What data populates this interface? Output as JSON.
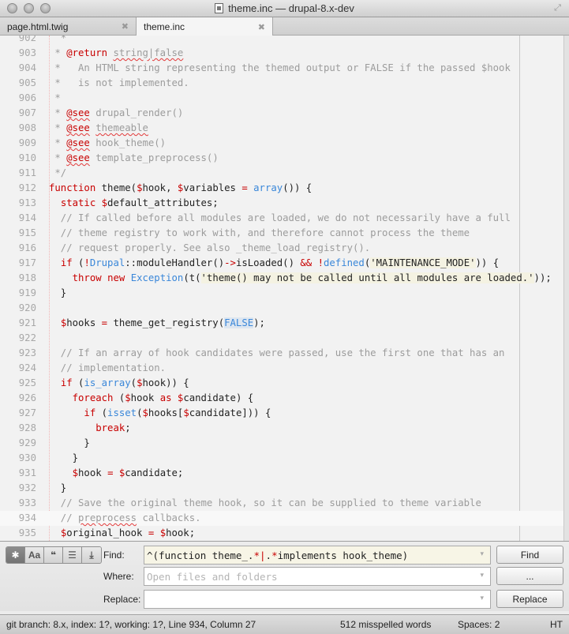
{
  "window": {
    "title": "theme.inc — drupal-8.x-dev"
  },
  "tabs": [
    {
      "label": "page.html.twig",
      "active": false
    },
    {
      "label": "theme.inc",
      "active": true
    }
  ],
  "editor": {
    "current_line": 934,
    "lines": [
      {
        "n": "902",
        "t": [
          [
            "cm",
            "  *"
          ]
        ]
      },
      {
        "n": "903",
        "t": [
          [
            "cm",
            " * "
          ],
          [
            "tag",
            "@return"
          ],
          [
            "cm",
            " "
          ],
          [
            "cms",
            "string|false"
          ]
        ]
      },
      {
        "n": "904",
        "t": [
          [
            "cm",
            " *   An HTML string representing the themed output or FALSE if the passed $hook"
          ]
        ]
      },
      {
        "n": "905",
        "t": [
          [
            "cm",
            " *   is not implemented."
          ]
        ]
      },
      {
        "n": "906",
        "t": [
          [
            "cm",
            " *"
          ]
        ]
      },
      {
        "n": "907",
        "t": [
          [
            "cm",
            " * "
          ],
          [
            "tags",
            "@see"
          ],
          [
            "cm",
            " drupal_render()"
          ]
        ]
      },
      {
        "n": "908",
        "t": [
          [
            "cm",
            " * "
          ],
          [
            "tags",
            "@see"
          ],
          [
            "cm",
            " "
          ],
          [
            "cms",
            "themeable"
          ]
        ]
      },
      {
        "n": "909",
        "t": [
          [
            "cm",
            " * "
          ],
          [
            "tags",
            "@see"
          ],
          [
            "cm",
            " hook_theme()"
          ]
        ]
      },
      {
        "n": "910",
        "t": [
          [
            "cm",
            " * "
          ],
          [
            "tags",
            "@see"
          ],
          [
            "cm",
            " template_preprocess()"
          ]
        ]
      },
      {
        "n": "911",
        "t": [
          [
            "cm",
            " */"
          ]
        ]
      },
      {
        "n": "912",
        "t": [
          [
            "kw",
            "function"
          ],
          [
            "tx",
            " theme("
          ],
          [
            "var",
            "$"
          ],
          [
            "tx",
            "hook, "
          ],
          [
            "var",
            "$"
          ],
          [
            "tx",
            "variables "
          ],
          [
            "op",
            "="
          ],
          [
            "tx",
            " "
          ],
          [
            "fn",
            "array"
          ],
          [
            "tx",
            "()) {"
          ]
        ]
      },
      {
        "n": "913",
        "t": [
          [
            "tx",
            "  "
          ],
          [
            "kw",
            "static"
          ],
          [
            "tx",
            " "
          ],
          [
            "var",
            "$"
          ],
          [
            "tx",
            "default_attributes;"
          ]
        ]
      },
      {
        "n": "914",
        "t": [
          [
            "cm",
            "  // If called before all modules are loaded, we do not necessarily have a full"
          ]
        ]
      },
      {
        "n": "915",
        "t": [
          [
            "cm",
            "  // theme registry to work with, and therefore cannot process the theme"
          ]
        ]
      },
      {
        "n": "916",
        "t": [
          [
            "cm",
            "  // request properly. See also _theme_load_registry()."
          ]
        ]
      },
      {
        "n": "917",
        "t": [
          [
            "tx",
            "  "
          ],
          [
            "kw",
            "if"
          ],
          [
            "tx",
            " ("
          ],
          [
            "op",
            "!"
          ],
          [
            "fn",
            "Drupal"
          ],
          [
            "tx",
            "::moduleHandler()"
          ],
          [
            "op",
            "->"
          ],
          [
            "tx",
            "isLoaded() "
          ],
          [
            "op",
            "&&"
          ],
          [
            "tx",
            " "
          ],
          [
            "op",
            "!"
          ],
          [
            "fn",
            "defined"
          ],
          [
            "tx",
            "("
          ],
          [
            "str",
            "'MAINTENANCE_MODE'"
          ],
          [
            "tx",
            ")) {"
          ]
        ]
      },
      {
        "n": "918",
        "t": [
          [
            "tx",
            "    "
          ],
          [
            "kw",
            "throw"
          ],
          [
            "tx",
            " "
          ],
          [
            "kw",
            "new"
          ],
          [
            "tx",
            " "
          ],
          [
            "fn",
            "Exception"
          ],
          [
            "tx",
            "(t("
          ],
          [
            "str",
            "'theme() may not be called until all modules are loaded.'"
          ],
          [
            "tx",
            "));"
          ]
        ]
      },
      {
        "n": "919",
        "t": [
          [
            "tx",
            "  }"
          ]
        ]
      },
      {
        "n": "920",
        "t": [
          [
            "tx",
            ""
          ]
        ]
      },
      {
        "n": "921",
        "t": [
          [
            "tx",
            "  "
          ],
          [
            "var",
            "$"
          ],
          [
            "tx",
            "hooks "
          ],
          [
            "op",
            "="
          ],
          [
            "tx",
            " theme_get_registry("
          ],
          [
            "const",
            "FALSE"
          ],
          [
            "tx",
            ");"
          ]
        ]
      },
      {
        "n": "922",
        "t": [
          [
            "tx",
            ""
          ]
        ]
      },
      {
        "n": "923",
        "t": [
          [
            "cm",
            "  // If an array of hook candidates were passed, use the first one that has an"
          ]
        ]
      },
      {
        "n": "924",
        "t": [
          [
            "cm",
            "  // implementation."
          ]
        ]
      },
      {
        "n": "925",
        "t": [
          [
            "tx",
            "  "
          ],
          [
            "kw",
            "if"
          ],
          [
            "tx",
            " ("
          ],
          [
            "fn",
            "is_array"
          ],
          [
            "tx",
            "("
          ],
          [
            "var",
            "$"
          ],
          [
            "tx",
            "hook)) {"
          ]
        ]
      },
      {
        "n": "926",
        "t": [
          [
            "tx",
            "    "
          ],
          [
            "kw",
            "foreach"
          ],
          [
            "tx",
            " ("
          ],
          [
            "var",
            "$"
          ],
          [
            "tx",
            "hook "
          ],
          [
            "kw",
            "as"
          ],
          [
            "tx",
            " "
          ],
          [
            "var",
            "$"
          ],
          [
            "tx",
            "candidate) {"
          ]
        ]
      },
      {
        "n": "927",
        "t": [
          [
            "tx",
            "      "
          ],
          [
            "kw",
            "if"
          ],
          [
            "tx",
            " ("
          ],
          [
            "fn",
            "isset"
          ],
          [
            "tx",
            "("
          ],
          [
            "var",
            "$"
          ],
          [
            "tx",
            "hooks["
          ],
          [
            "var",
            "$"
          ],
          [
            "tx",
            "candidate])) {"
          ]
        ]
      },
      {
        "n": "928",
        "t": [
          [
            "tx",
            "        "
          ],
          [
            "kw",
            "break"
          ],
          [
            "tx",
            ";"
          ]
        ]
      },
      {
        "n": "929",
        "t": [
          [
            "tx",
            "      }"
          ]
        ]
      },
      {
        "n": "930",
        "t": [
          [
            "tx",
            "    }"
          ]
        ]
      },
      {
        "n": "931",
        "t": [
          [
            "tx",
            "    "
          ],
          [
            "var",
            "$"
          ],
          [
            "tx",
            "hook "
          ],
          [
            "op",
            "="
          ],
          [
            "tx",
            " "
          ],
          [
            "var",
            "$"
          ],
          [
            "tx",
            "candidate;"
          ]
        ]
      },
      {
        "n": "932",
        "t": [
          [
            "tx",
            "  }"
          ]
        ]
      },
      {
        "n": "933",
        "t": [
          [
            "cm",
            "  // Save the original theme hook, so it can be supplied to theme variable"
          ]
        ]
      },
      {
        "n": "934",
        "t": [
          [
            "cm",
            "  // "
          ],
          [
            "cms",
            "preprocess"
          ],
          [
            "cm",
            " callbacks."
          ]
        ]
      },
      {
        "n": "935",
        "t": [
          [
            "tx",
            "  "
          ],
          [
            "var",
            "$"
          ],
          [
            "tx",
            "original_hook "
          ],
          [
            "op",
            "="
          ],
          [
            "tx",
            " "
          ],
          [
            "var",
            "$"
          ],
          [
            "tx",
            "hook;"
          ]
        ]
      }
    ]
  },
  "find_panel": {
    "options": [
      {
        "name": "regex-toggle",
        "glyph": "✱",
        "on": true
      },
      {
        "name": "case-sensitive-toggle",
        "glyph": "Aa",
        "on": false
      },
      {
        "name": "whole-word-toggle",
        "glyph": "❝",
        "on": false
      },
      {
        "name": "show-context-toggle",
        "glyph": "☰",
        "on": false
      },
      {
        "name": "use-buffer-toggle",
        "glyph": "⤓",
        "on": false
      }
    ],
    "find_label": "Find:",
    "find_value_parts": [
      [
        "tx",
        "^(function theme_."
      ],
      [
        "meta",
        "*|"
      ],
      [
        "tx",
        "."
      ],
      [
        "meta",
        "*"
      ],
      [
        "tx",
        "implements hook_theme)"
      ]
    ],
    "where_label": "Where:",
    "where_placeholder": "Open files and folders",
    "replace_label": "Replace:",
    "replace_value": "",
    "find_button": "Find",
    "where_button": "...",
    "replace_button": "Replace"
  },
  "status_bar": {
    "git": "git branch: 8.x, index: 1?, working: 1?, Line 934, Column 27",
    "spelling": "512 misspelled words",
    "indent": "Spaces: 2",
    "syntax": "HT"
  }
}
